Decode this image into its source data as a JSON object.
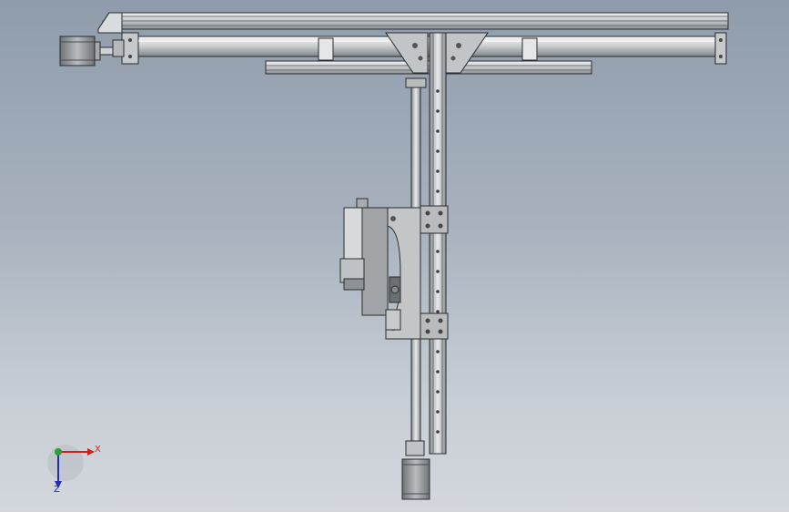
{
  "view": {
    "background_top": "#8f9cab",
    "background_bottom": "#d3d7dc"
  },
  "model": {
    "frame_color": "#c8cbcd",
    "frame_shadow": "#6e7378",
    "edge_color": "#2a2c2e",
    "motor_color": "#9a9d9f",
    "carriage_color": "#b9bbbd"
  },
  "triad": {
    "x_label": "X",
    "z_label": "Z",
    "x_color": "#d01f1f",
    "z_color": "#1f2fb0",
    "origin_color": "#2e9e3a"
  }
}
